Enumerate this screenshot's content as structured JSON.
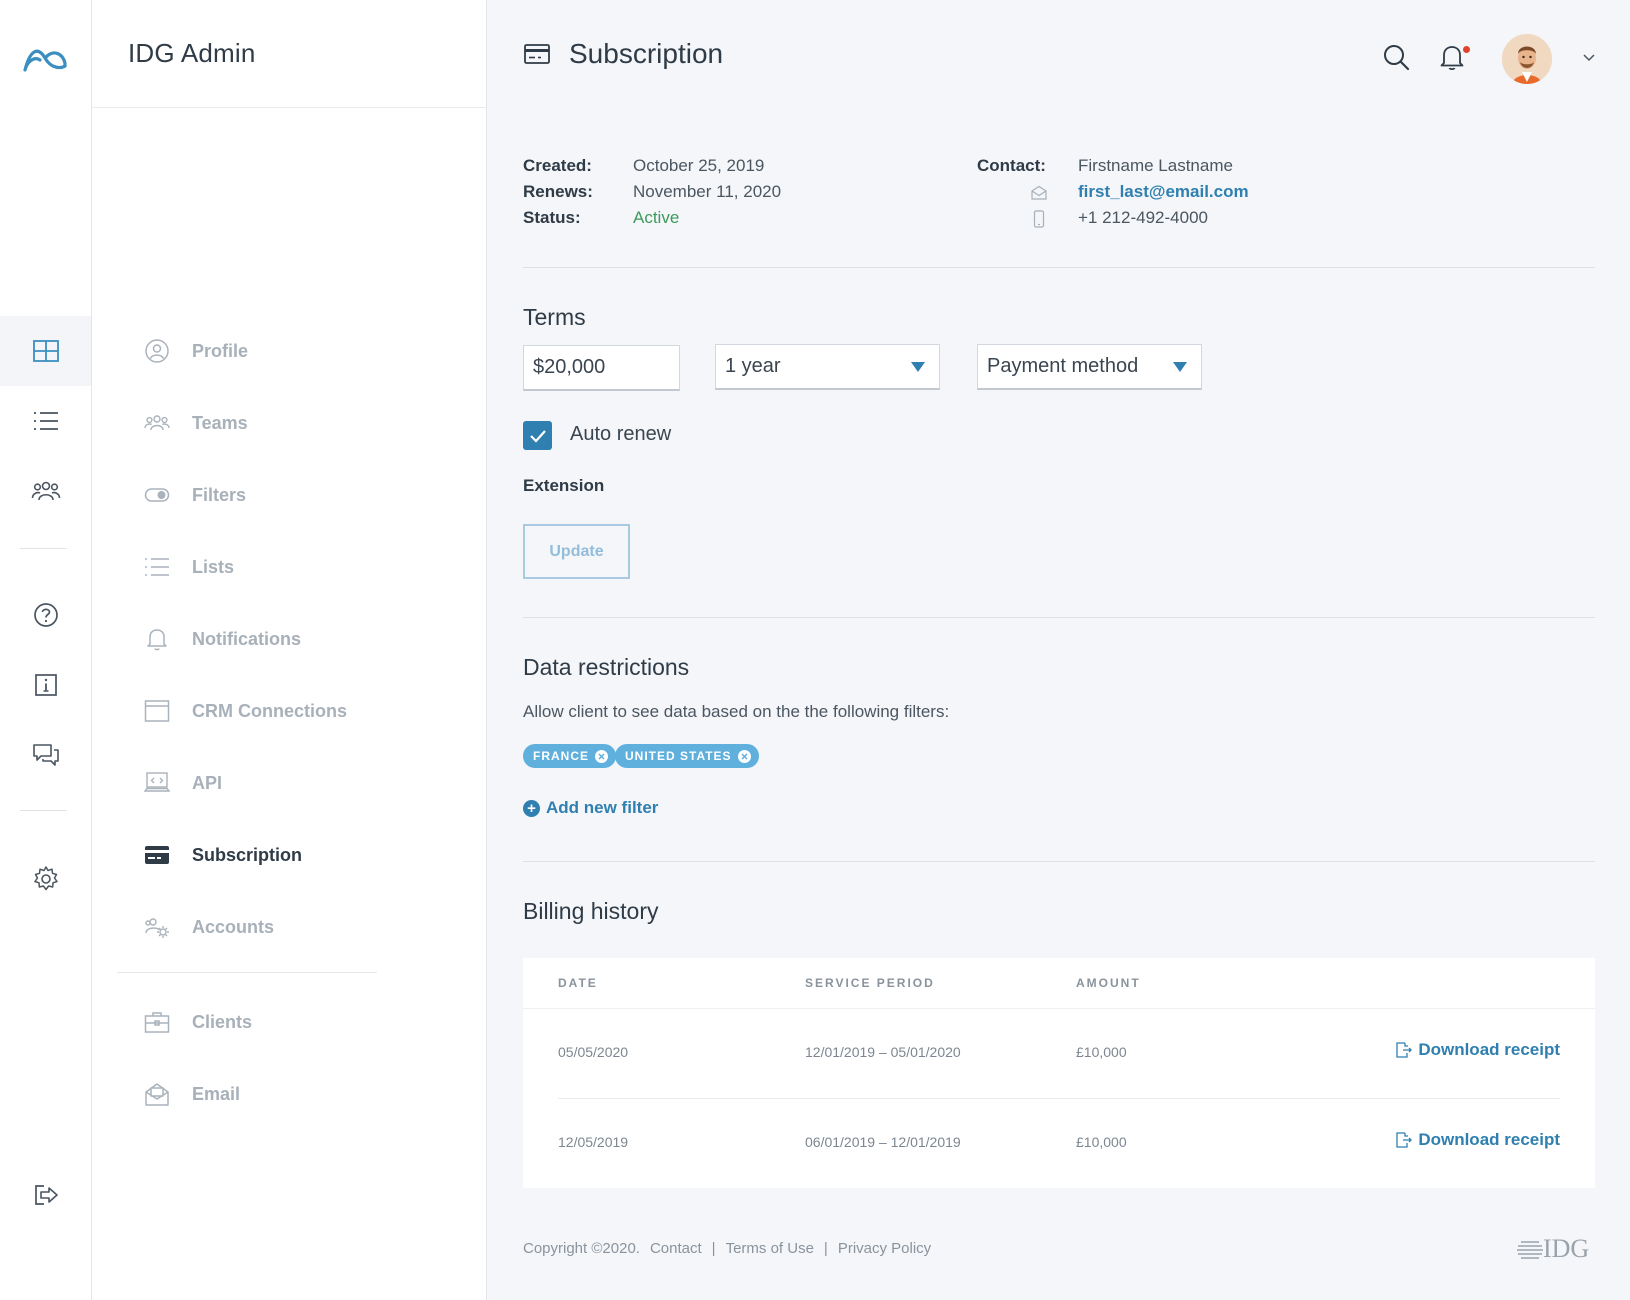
{
  "sidebar": {
    "title": "IDG Admin",
    "items": [
      {
        "label": "Profile",
        "icon": "user-circle-icon"
      },
      {
        "label": "Teams",
        "icon": "team-icon"
      },
      {
        "label": "Filters",
        "icon": "toggle-icon"
      },
      {
        "label": "Lists",
        "icon": "list-icon"
      },
      {
        "label": "Notifications",
        "icon": "bell-icon"
      },
      {
        "label": "CRM Connections",
        "icon": "browser-window-icon"
      },
      {
        "label": "API",
        "icon": "code-laptop-icon"
      },
      {
        "label": "Subscription",
        "icon": "credit-card-icon",
        "active": true
      },
      {
        "label": "Accounts",
        "icon": "users-gear-icon"
      },
      {
        "label": "Clients",
        "icon": "briefcase-icon"
      },
      {
        "label": "Email",
        "icon": "mail-open-icon"
      }
    ]
  },
  "header": {
    "title": "Subscription"
  },
  "info": {
    "created_label": "Created:",
    "created_value": "October 25, 2019",
    "renews_label": "Renews:",
    "renews_value": "November 11, 2020",
    "status_label": "Status:",
    "status_value": "Active",
    "contact_label": "Contact:",
    "contact_name": "Firstname Lastname",
    "contact_email": "first_last@email.com",
    "contact_phone": "+1 212-492-4000"
  },
  "terms": {
    "title": "Terms",
    "amount_value": "$20,000",
    "duration_value": "1 year",
    "payment_placeholder": "Payment method",
    "auto_renew_label": "Auto renew",
    "auto_renew_checked": true,
    "extension_label": "Extension",
    "update_label": "Update"
  },
  "restrictions": {
    "title": "Data restrictions",
    "description": "Allow client to see data based on the the following filters:",
    "chips": [
      "FRANCE",
      "UNITED STATES"
    ],
    "add_filter_label": "Add new filter"
  },
  "billing": {
    "title": "Billing history",
    "columns": [
      "DATE",
      "SERVICE PERIOD",
      "AMOUNT"
    ],
    "rows": [
      {
        "date": "05/05/2020",
        "period": "12/01/2019 – 05/01/2020",
        "amount": "£10,000",
        "action": "Download receipt"
      },
      {
        "date": "12/05/2019",
        "period": "06/01/2019 – 12/01/2019",
        "amount": "£10,000",
        "action": "Download receipt"
      }
    ]
  },
  "footer": {
    "copyright": "Copyright ©2020.",
    "contact": "Contact",
    "terms": "Terms of Use",
    "privacy": "Privacy Policy",
    "separator": "|",
    "brand": "IDG"
  },
  "colors": {
    "accent": "#2f7fb0",
    "active_status": "#3d9a5c",
    "chip": "#5fb0dd",
    "background": "#f4f6f9"
  }
}
